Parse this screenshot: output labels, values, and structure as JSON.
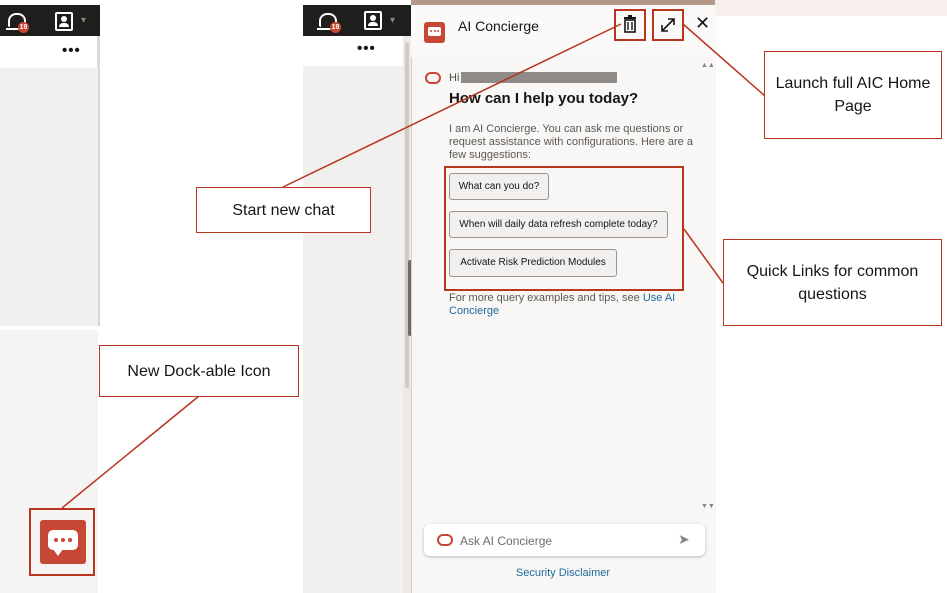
{
  "left_strip": {
    "notification_count": "19",
    "more_label": "•••"
  },
  "middle_strip": {
    "notification_count": "19",
    "more_label": "•••"
  },
  "panel": {
    "title": "AI Concierge",
    "greeting": "Hi",
    "heading": "How can I help you today?",
    "intro": "I am AI Concierge. You can ask me questions or request assistance with configurations. Here are a few suggestions:",
    "suggestions": [
      "What can you do?",
      "When will daily data refresh complete today?",
      "Activate Risk Prediction Modules"
    ],
    "more_text": "For more query examples and tips, see ",
    "more_link": "Use AI Concierge",
    "input_placeholder": "Ask AI Concierge",
    "disclaimer": "Security Disclaimer"
  },
  "callouts": {
    "start_new_chat": "Start new chat",
    "launch_full": "Launch full AIC Home Page",
    "quick_links": "Quick Links for common questions",
    "dockable_icon": "New Dock-able Icon"
  },
  "colors": {
    "brand_red": "#c74634",
    "callout_border": "#b8351f",
    "topbar": "#201e1c",
    "link": "#1e6a9c"
  },
  "icons": [
    "bell-icon",
    "profile-icon",
    "chat-bubble-icon",
    "trash-icon",
    "expand-icon",
    "close-icon",
    "send-icon"
  ]
}
